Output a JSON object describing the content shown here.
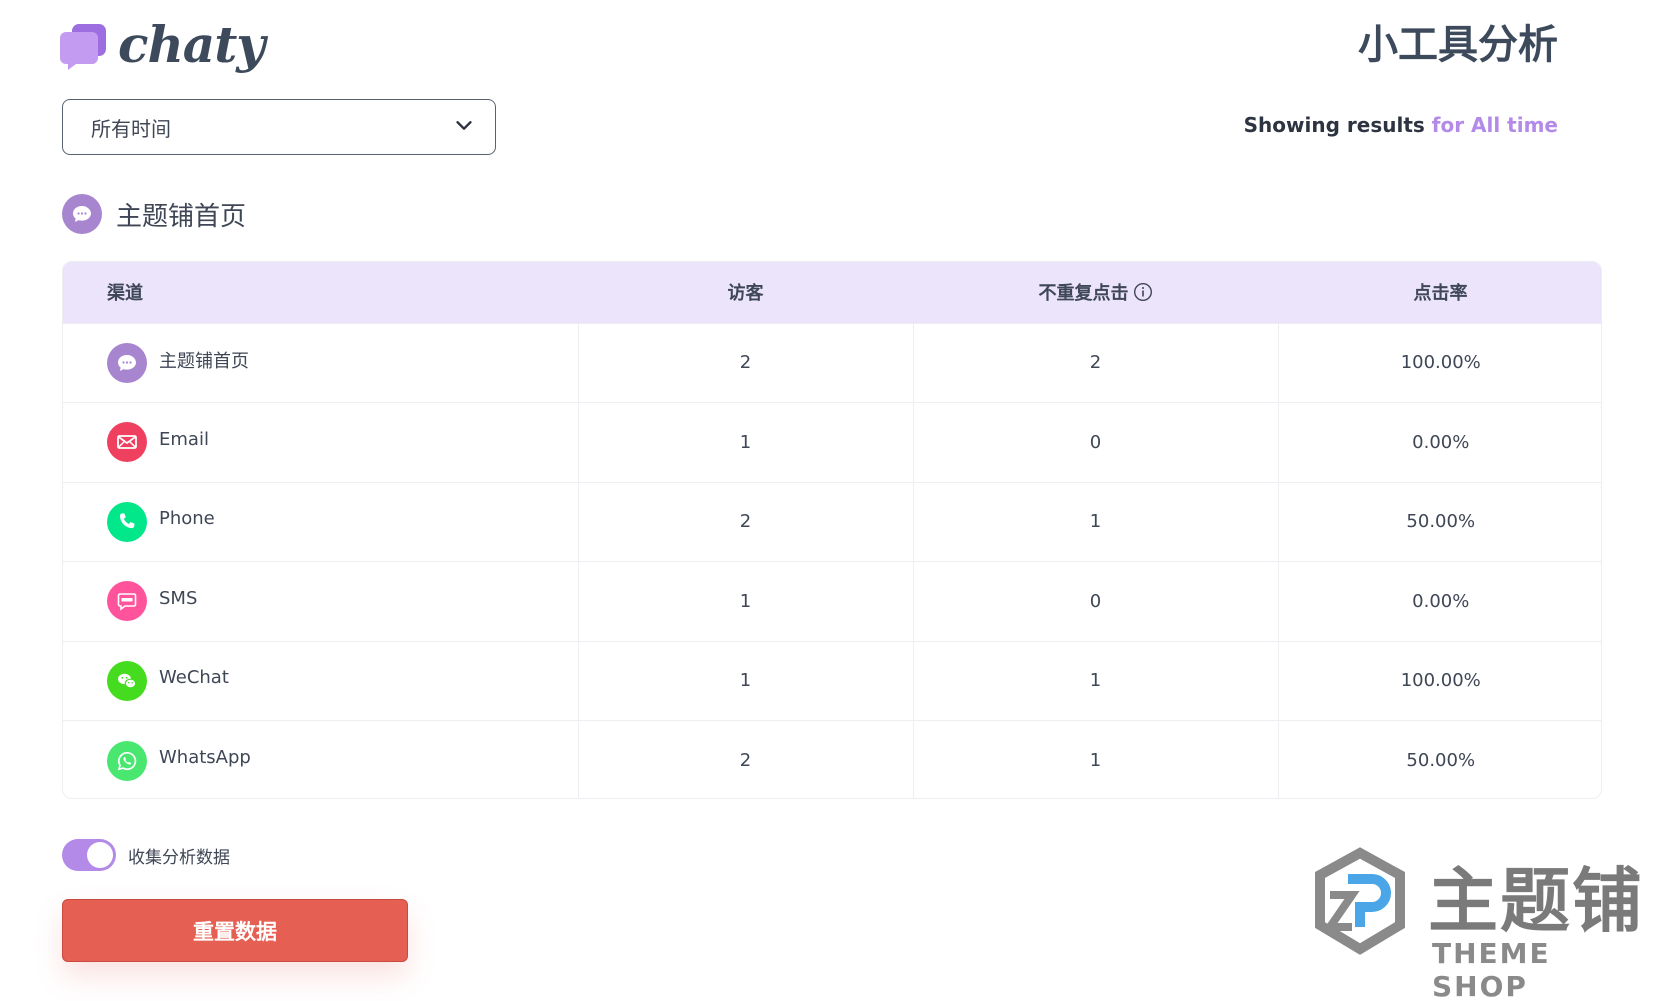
{
  "brand": {
    "logo_text": "chaty",
    "accent_color": "#b48ae8"
  },
  "header": {
    "title": "小工具分析"
  },
  "filter": {
    "selected_period": "所有时间",
    "showing_prefix": "Showing results",
    "showing_suffix": "for All time"
  },
  "widget": {
    "name": "主题铺首页",
    "icon": "chat-bubble-icon"
  },
  "table": {
    "headers": {
      "channel": "渠道",
      "visitors": "访客",
      "unique_clicks": "不重复点击",
      "click_rate": "点击率"
    },
    "rows": [
      {
        "channel": "主题铺首页",
        "icon": "chat-bubble-icon",
        "color": "#a886cf",
        "visitors": "2",
        "unique_clicks": "2",
        "click_rate": "100.00%"
      },
      {
        "channel": "Email",
        "icon": "email-icon",
        "color": "#ef4060",
        "visitors": "1",
        "unique_clicks": "0",
        "click_rate": "0.00%"
      },
      {
        "channel": "Phone",
        "icon": "phone-icon",
        "color": "#03e78b",
        "visitors": "2",
        "unique_clicks": "1",
        "click_rate": "50.00%"
      },
      {
        "channel": "SMS",
        "icon": "sms-icon",
        "color": "#ff549c",
        "visitors": "1",
        "unique_clicks": "0",
        "click_rate": "0.00%"
      },
      {
        "channel": "WeChat",
        "icon": "wechat-icon",
        "color": "#45dc1f",
        "visitors": "1",
        "unique_clicks": "1",
        "click_rate": "100.00%"
      },
      {
        "channel": "WhatsApp",
        "icon": "whatsapp-icon",
        "color": "#49e670",
        "visitors": "2",
        "unique_clicks": "1",
        "click_rate": "50.00%"
      }
    ]
  },
  "controls": {
    "collect_label": "收集分析数据",
    "collect_enabled": true,
    "reset_label": "重置数据"
  },
  "watermark": {
    "main": "主题铺",
    "sub": "THEME SHOP"
  }
}
